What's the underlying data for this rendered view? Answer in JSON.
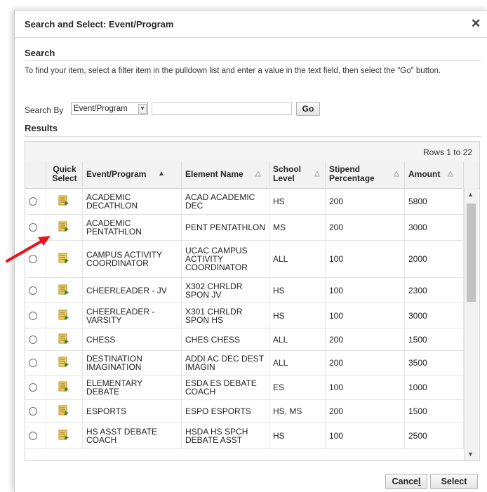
{
  "dialog": {
    "title": "Search and Select: Event/Program",
    "close_icon": "close-icon"
  },
  "search": {
    "heading": "Search",
    "instructions": "To find your item, select a filter item in the pulldown list and enter a value in the text field, then select the \"Go\" button.",
    "search_by_label": "Search By",
    "search_by_value": "Event/Program",
    "search_input_value": "",
    "go_label": "Go"
  },
  "results": {
    "heading": "Results",
    "rows_info": "Rows 1 to 22",
    "columns": {
      "quick_select_line1": "Quick",
      "quick_select_line2": "Select",
      "event_program": "Event/Program",
      "element_name": "Element Name",
      "school_level_line1": "School",
      "school_level_line2": "Level",
      "stipend_line1": "Stipend",
      "stipend_line2": "Percentage",
      "amount": "Amount"
    },
    "sorted_column": "Event/Program",
    "rows": [
      {
        "event_l1": "ACADEMIC",
        "event_l2": "DECATHLON",
        "element_l1": "ACAD ACADEMIC",
        "element_l2": "DEC",
        "level": "HS",
        "stipend": "200",
        "amount": "5800"
      },
      {
        "event_l1": "ACADEMIC",
        "event_l2": "PENTATHLON",
        "element_l1": "PENT PENTATHLON",
        "element_l2": "",
        "level": "MS",
        "stipend": "200",
        "amount": "3000"
      },
      {
        "event_l1": "CAMPUS ACTIVITY",
        "event_l2": "COORDINATOR",
        "element_l1": "UCAC CAMPUS",
        "element_l2": "ACTIVITY",
        "element_l3": "COORDINATOR",
        "level": "ALL",
        "stipend": "100",
        "amount": "2000"
      },
      {
        "event_l1": "CHEERLEADER - JV",
        "event_l2": "",
        "element_l1": "X302 CHRLDR",
        "element_l2": "SPON JV",
        "level": "HS",
        "stipend": "100",
        "amount": "2300"
      },
      {
        "event_l1": "CHEERLEADER -",
        "event_l2": "VARSITY",
        "element_l1": "X301 CHRLDR",
        "element_l2": "SPON HS",
        "level": "HS",
        "stipend": "100",
        "amount": "3000"
      },
      {
        "event_l1": "CHESS",
        "event_l2": "",
        "element_l1": "CHES CHESS",
        "element_l2": "",
        "level": "ALL",
        "stipend": "200",
        "amount": "1500"
      },
      {
        "event_l1": "DESTINATION",
        "event_l2": "IMAGINATION",
        "element_l1": "ADDI AC DEC DEST",
        "element_l2": "IMAGIN",
        "level": "ALL",
        "stipend": "200",
        "amount": "3500"
      },
      {
        "event_l1": "ELEMENTARY",
        "event_l2": "DEBATE",
        "element_l1": "ESDA ES DEBATE",
        "element_l2": "COACH",
        "level": "ES",
        "stipend": "100",
        "amount": "1000"
      },
      {
        "event_l1": "ESPORTS",
        "event_l2": "",
        "element_l1": "ESPO ESPORTS",
        "element_l2": "",
        "level": "HS, MS",
        "stipend": "200",
        "amount": "1500"
      },
      {
        "event_l1": "HS ASST DEBATE",
        "event_l2": "COACH",
        "element_l1": "HSDA HS SPCH",
        "element_l2": "DEBATE ASST",
        "level": "HS",
        "stipend": "100",
        "amount": "2500"
      }
    ]
  },
  "footer": {
    "cancel_pre": "Cance",
    "cancel_underlined": "l",
    "select_label": "Select"
  },
  "colors": {
    "annotation_arrow": "#e8141b",
    "quick_select_icon": "#e8c24a"
  }
}
